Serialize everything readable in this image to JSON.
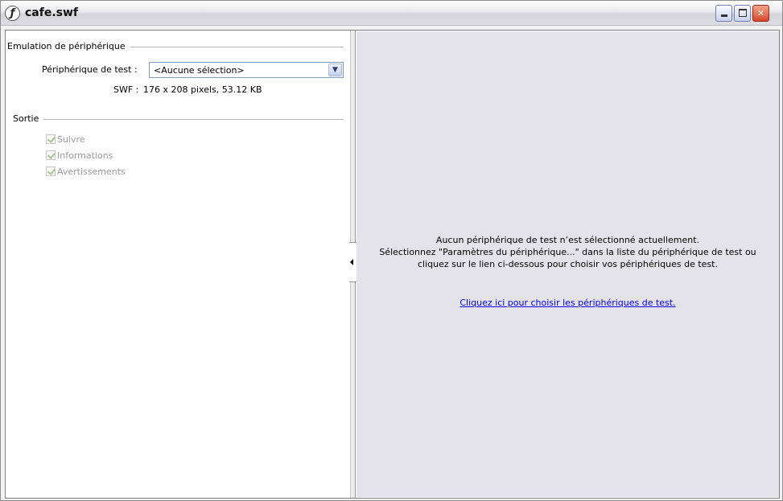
{
  "window": {
    "title": "cafe.swf",
    "app_icon": "flash-icon",
    "controls": {
      "minimize_icon": "minimize-icon",
      "maximize_icon": "maximize-icon",
      "close_icon": "close-icon"
    }
  },
  "left": {
    "emulation_section": "Emulation de périphérique",
    "test_device_label": "Périphérique de test :",
    "test_device_value": "<Aucune sélection>",
    "swf_label": "SWF :",
    "swf_value": "176 x 208 pixels, 53.12 KB",
    "output_section": "Sortie",
    "checkboxes": [
      {
        "label": "Suivre",
        "checked": true,
        "enabled": false
      },
      {
        "label": "Informations",
        "checked": true,
        "enabled": false
      },
      {
        "label": "Avertissements",
        "checked": true,
        "enabled": false
      }
    ]
  },
  "right": {
    "message_lines": [
      "Aucun périphérique de test n’est sélectionné actuellement.",
      "Sélectionnez \"Paramètres du périphérique...\" dans la liste du périphérique de test ou",
      "cliquez sur le lien ci-dessous pour choisir vos périphériques de test."
    ],
    "link": "Cliquez ici pour choisir les périphériques de test."
  },
  "colors": {
    "right_pane_bg": "#e4e3ea",
    "link": "#0000ee",
    "close_button": "#d5462b"
  }
}
